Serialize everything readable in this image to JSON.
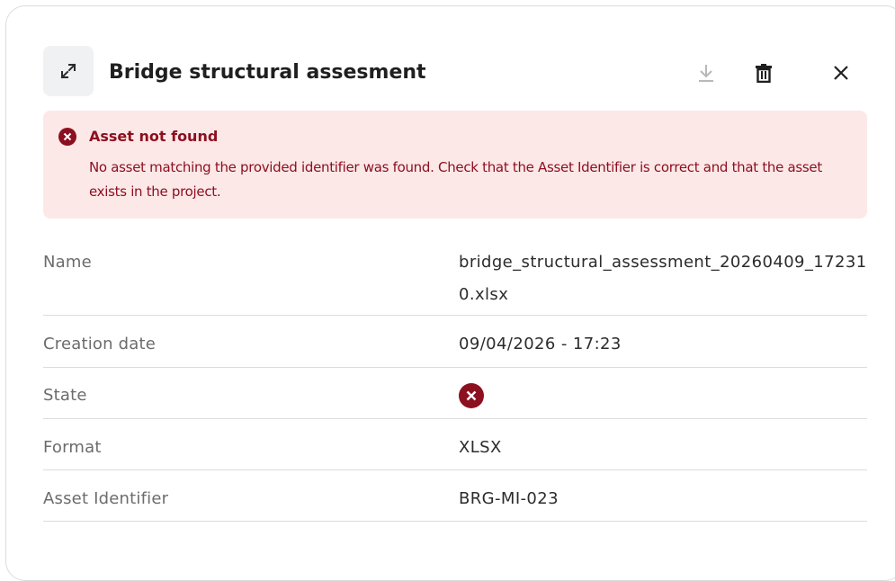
{
  "header": {
    "title": "Bridge structural assesment",
    "expand_icon": "expand-arrows-icon",
    "download_icon": "download-icon",
    "delete_icon": "trash-icon",
    "close_icon": "close-icon"
  },
  "alert": {
    "title": "Asset not found",
    "message": "No asset matching the provided identifier was found. Check that the Asset Identifier is correct and that the asset exists in the project.",
    "icon": "error-circle-icon",
    "background_color": "#fde8e8",
    "text_color": "#8c1020"
  },
  "details": {
    "name": {
      "label": "Name",
      "value": "bridge_structural_assessment_20260409_172310.xlsx"
    },
    "creation_date": {
      "label": "Creation date",
      "value": "09/04/2026 - 17:23"
    },
    "state": {
      "label": "State",
      "icon": "error-circle-icon",
      "color": "#8c1020"
    },
    "format": {
      "label": "Format",
      "value": "XLSX"
    },
    "asset_identifier": {
      "label": "Asset Identifier",
      "value": "BRG-MI-023"
    }
  }
}
